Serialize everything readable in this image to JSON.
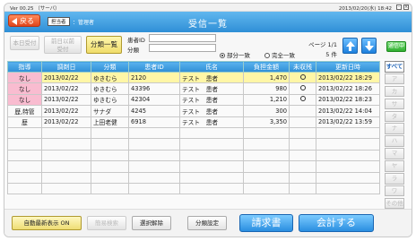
{
  "titlebar": {
    "version": "Ver 00.25 （サーバ）",
    "datetime": "2013/02/20(水) 18:42"
  },
  "header": {
    "back_label": "戻る",
    "role_tag": "担当者",
    "role_name": "：管理者",
    "title": "受信一覧"
  },
  "toolbar": {
    "today_label": "本日受付",
    "prev_label_1": "前日以前",
    "prev_label_2": "受付",
    "category_list_label": "分類一覧",
    "patient_id_label": "患者ID",
    "category_label": "分類",
    "match_partial": "部分一致",
    "match_exact": "完全一致",
    "page": "ページ 1/1",
    "count": "5 件",
    "comm_label": "通信中"
  },
  "table": {
    "headers": [
      "指導",
      "調剤日",
      "分類",
      "患者ID",
      "氏名",
      "負担金額",
      "未収残",
      "更新日時"
    ],
    "rows": [
      {
        "guide": "なし",
        "date": "2013/02/22",
        "category": "ゆきむら",
        "pid": "2120",
        "name": "テスト　患者",
        "amount": "1,470",
        "unpaid": "o",
        "updated": "2013/02/22 18:29"
      },
      {
        "guide": "なし",
        "date": "2013/02/22",
        "category": "ゆきむら",
        "pid": "43396",
        "name": "テスト　患者",
        "amount": "980",
        "unpaid": "o",
        "updated": "2013/02/22 18:26"
      },
      {
        "guide": "なし",
        "date": "2013/02/22",
        "category": "ゆきむら",
        "pid": "42304",
        "name": "テスト　患者",
        "amount": "1,210",
        "unpaid": "o",
        "updated": "2013/02/22 18:23"
      },
      {
        "guide": "歴,特管",
        "date": "2013/02/22",
        "category": "サナダ",
        "pid": "4245",
        "name": "テスト　患者",
        "amount": "300",
        "unpaid": "",
        "updated": "2013/02/22 14:04"
      },
      {
        "guide": "歴",
        "date": "2013/02/22",
        "category": "上田老健",
        "pid": "6918",
        "name": "テスト　患者",
        "amount": "3,350",
        "unpaid": "",
        "updated": "2013/02/22 13:59"
      }
    ]
  },
  "kana_index": [
    "すべて",
    "ア",
    "カ",
    "サ",
    "タ",
    "ナ",
    "ハ",
    "マ",
    "ヤ",
    "ラ",
    "ワ",
    "その他"
  ],
  "bottom": {
    "auto_refresh": "自動最新表示 ON",
    "simple_search": "簡易検索",
    "clear_selection": "選択解除",
    "category_setting": "分類設定",
    "invoice": "請求書",
    "checkout": "会計する"
  }
}
